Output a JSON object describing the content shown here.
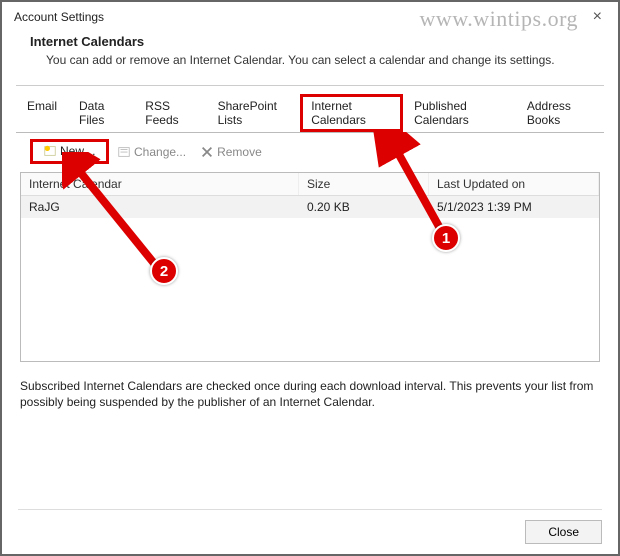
{
  "window": {
    "title": "Account Settings"
  },
  "watermark": "www.wintips.org",
  "header": {
    "title": "Internet Calendars",
    "subtitle": "You can add or remove an Internet Calendar. You can select a calendar and change its settings."
  },
  "tabs": {
    "email": "Email",
    "datafiles": "Data Files",
    "rss": "RSS Feeds",
    "sharepoint": "SharePoint Lists",
    "internetcal": "Internet Calendars",
    "publishedcal": "Published Calendars",
    "addressbooks": "Address Books"
  },
  "toolbar": {
    "new": "New…",
    "change": "Change...",
    "remove": "Remove"
  },
  "list": {
    "columns": {
      "name": "Internet Calendar",
      "size": "Size",
      "updated": "Last Updated on"
    },
    "rows": [
      {
        "name": "RaJG",
        "size": "0.20 KB",
        "updated": "5/1/2023 1:39 PM"
      }
    ]
  },
  "note": "Subscribed Internet Calendars are checked once during each download interval. This prevents your list from possibly being suspended by the publisher of an Internet Calendar.",
  "footer": {
    "close": "Close"
  },
  "badges": {
    "b1": "1",
    "b2": "2"
  }
}
